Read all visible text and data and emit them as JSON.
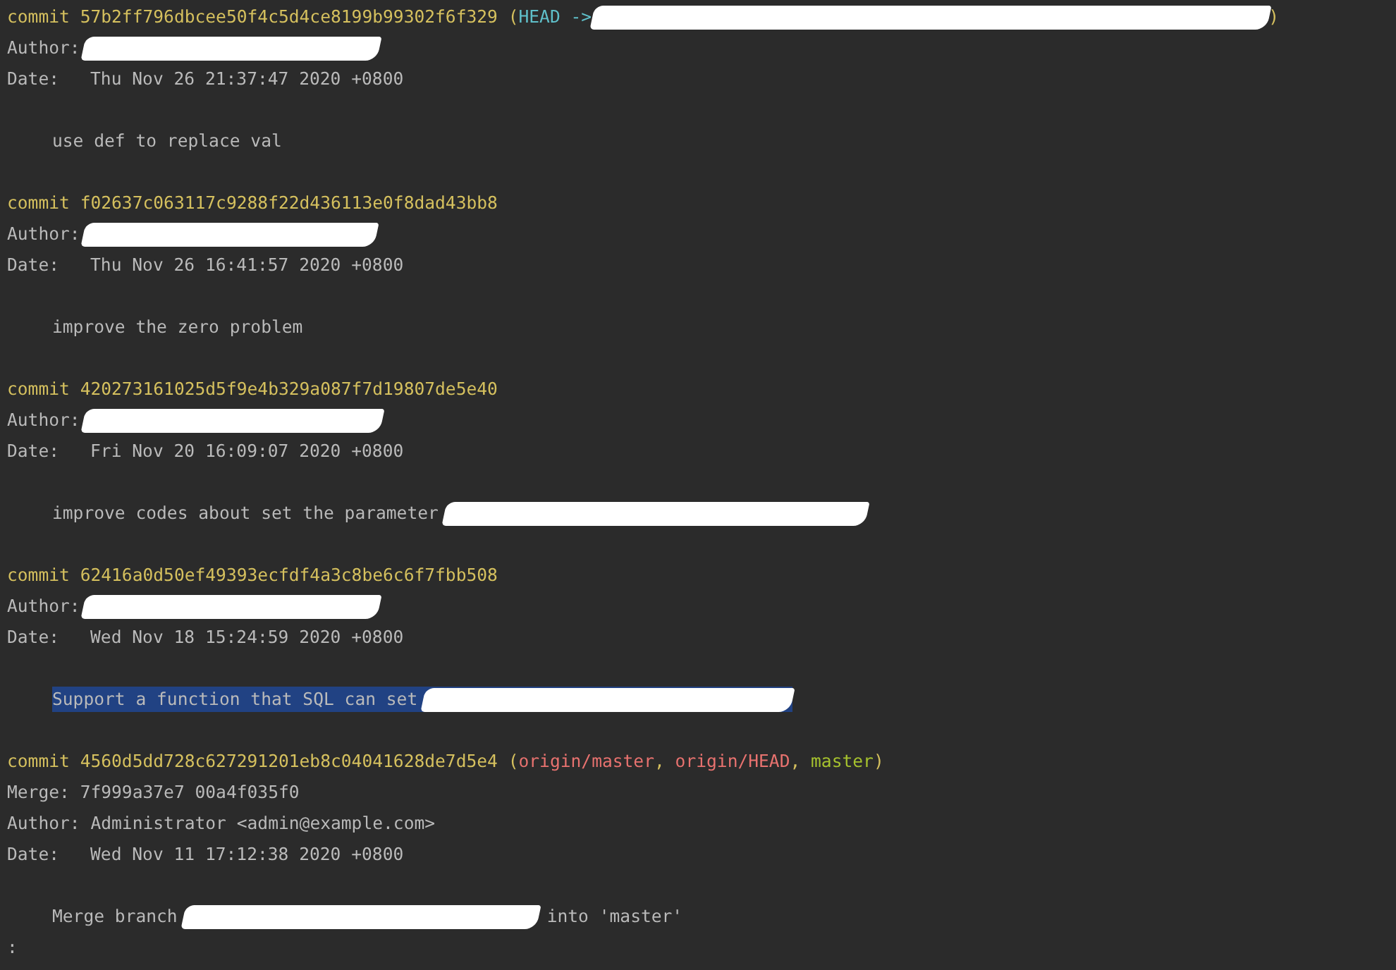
{
  "commits": [
    {
      "label": "commit",
      "hash": "57b2ff796dbcee50f4c5d4ce8199b99302f6f329",
      "refs": {
        "open": "(",
        "items": [
          {
            "kind": "head",
            "text": "HEAD ->"
          },
          {
            "kind": "redacted"
          }
        ],
        "close": ")"
      },
      "author": {
        "label": "Author:",
        "redacted": true
      },
      "date": {
        "label": "Date:",
        "value": "Thu Nov 26 21:37:47 2020 +0800"
      },
      "message": {
        "text": "use def to replace val",
        "redacted": false,
        "selected": false
      }
    },
    {
      "label": "commit",
      "hash": "f02637c063117c9288f22d436113e0f8dad43bb8",
      "author": {
        "label": "Author:",
        "redacted": true
      },
      "date": {
        "label": "Date:",
        "value": "Thu Nov 26 16:41:57 2020 +0800"
      },
      "message": {
        "text": "improve the zero problem",
        "redacted": false,
        "selected": false
      }
    },
    {
      "label": "commit",
      "hash": "420273161025d5f9e4b329a087f7d19807de5e40",
      "author": {
        "label": "Author:",
        "redacted": true
      },
      "date": {
        "label": "Date:",
        "value": "Fri Nov 20 16:09:07 2020 +0800"
      },
      "message": {
        "text": "improve codes about set the parameter",
        "redacted": true,
        "selected": false
      }
    },
    {
      "label": "commit",
      "hash": "62416a0d50ef49393ecfdf4a3c8be6c6f7fbb508",
      "author": {
        "label": "Author:",
        "redacted": true
      },
      "date": {
        "label": "Date:",
        "value": "Wed Nov 18 15:24:59 2020 +0800"
      },
      "message": {
        "text": "Support a function that SQL can set",
        "redacted": true,
        "selected": true
      }
    },
    {
      "label": "commit",
      "hash": "4560d5dd728c627291201eb8c04041628de7d5e4",
      "refs": {
        "open": "(",
        "separator": ",",
        "items": [
          {
            "kind": "remote",
            "text": "origin/master"
          },
          {
            "kind": "remote",
            "text": "origin/HEAD"
          },
          {
            "kind": "local",
            "text": "master"
          }
        ],
        "close": ")"
      },
      "merge": {
        "label": "Merge:",
        "value": "7f999a37e7 00a4f035f0"
      },
      "author": {
        "label": "Author:",
        "value": "Administrator <admin@example.com>",
        "redacted": false
      },
      "date": {
        "label": "Date:",
        "value": "Wed Nov 11 17:12:38 2020 +0800"
      },
      "message": {
        "text": "Merge branch",
        "redacted": true,
        "suffix": "into 'master'",
        "selected": false
      }
    }
  ],
  "prompt": ":"
}
